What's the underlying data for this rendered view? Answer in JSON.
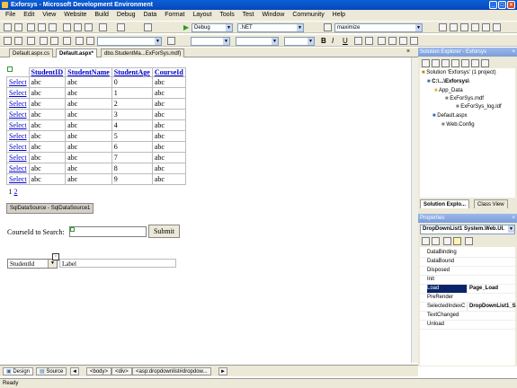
{
  "title": "Exforsys - Microsoft Development Environment",
  "menu": [
    "File",
    "Edit",
    "View",
    "Website",
    "Build",
    "Debug",
    "Data",
    "Format",
    "Layout",
    "Tools",
    "Test",
    "Window",
    "Community",
    "Help"
  ],
  "toolbar": {
    "config": "Debug",
    "platform": ".NET",
    "find": "maximize"
  },
  "tabs": [
    "Default.aspx.cs",
    "Default.aspx*",
    "dbo.StudentMa...ExForSys.mdf)"
  ],
  "grid": {
    "headers": [
      "StudentID",
      "StudentName",
      "StudentAge",
      "CourseId"
    ],
    "select_label": "Select",
    "rows": [
      [
        "abc",
        "abc",
        "0",
        "abc"
      ],
      [
        "abc",
        "abc",
        "1",
        "abc"
      ],
      [
        "abc",
        "abc",
        "2",
        "abc"
      ],
      [
        "abc",
        "abc",
        "3",
        "abc"
      ],
      [
        "abc",
        "abc",
        "4",
        "abc"
      ],
      [
        "abc",
        "abc",
        "5",
        "abc"
      ],
      [
        "abc",
        "abc",
        "6",
        "abc"
      ],
      [
        "abc",
        "abc",
        "7",
        "abc"
      ],
      [
        "abc",
        "abc",
        "8",
        "abc"
      ],
      [
        "abc",
        "abc",
        "9",
        "abc"
      ]
    ],
    "pager": [
      "1",
      "2"
    ]
  },
  "datasource": "SqlDataSource - SqlDataSource1",
  "search": {
    "label": "CourseId to Search:",
    "button": "Submit"
  },
  "dropdown": {
    "value": "StudentId"
  },
  "label_text": "Label",
  "solution": {
    "header": "Solution Explorer - Exforsys",
    "items": [
      "Solution 'Exforsys' (1 project)",
      "C:\\...\\Exforsys\\",
      "App_Data",
      "ExForSys.mdf",
      "ExForSys_log.ldf",
      "Default.aspx",
      "Web.Config"
    ],
    "tabs": [
      "Solution Explo...",
      "Class View"
    ]
  },
  "properties": {
    "header": "Properties",
    "object": "DropDownList1 System.Web.UI.",
    "rows": [
      {
        "name": "DataBinding",
        "value": ""
      },
      {
        "name": "DataBound",
        "value": ""
      },
      {
        "name": "Disposed",
        "value": ""
      },
      {
        "name": "Init",
        "value": ""
      },
      {
        "name": "Load",
        "value": "Page_Load"
      },
      {
        "name": "PreRender",
        "value": ""
      },
      {
        "name": "SelectedIndexC",
        "value": "DropDownList1_S"
      },
      {
        "name": "TextChanged",
        "value": ""
      },
      {
        "name": "Unload",
        "value": ""
      }
    ]
  },
  "bottom": {
    "design": "Design",
    "source": "Source",
    "crumbs": [
      "<body>",
      "<div>",
      "<asp:dropdownlist#dropdow..."
    ]
  },
  "status": "Ready"
}
